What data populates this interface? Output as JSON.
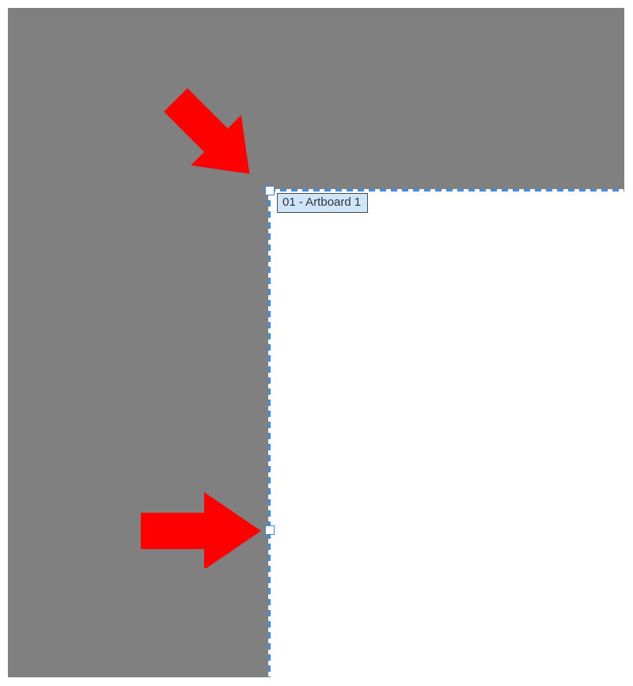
{
  "artboard": {
    "label": "01 - Artboard 1"
  },
  "colors": {
    "canvas_bg": "#808080",
    "artboard_bg": "#ffffff",
    "selection": "#3a8eea",
    "label_bg": "#cfe6fa",
    "annotation": "#ff0000"
  }
}
